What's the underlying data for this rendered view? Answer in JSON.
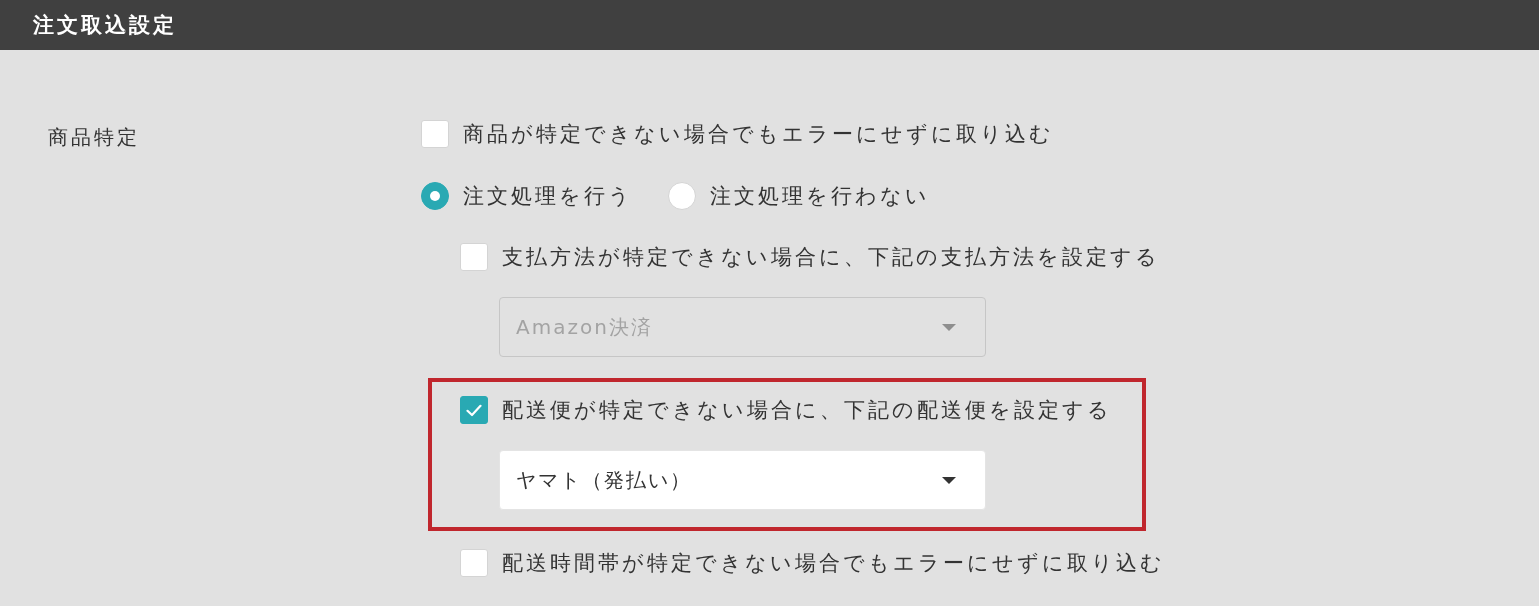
{
  "header": {
    "title": "注文取込設定"
  },
  "section": {
    "label": "商品特定",
    "items": [
      {
        "kind": "checkbox",
        "label": "商品が特定できない場合でもエラーにせずに取り込む",
        "checked": false
      },
      {
        "kind": "radio_group",
        "options": [
          {
            "label": "注文処理を行う",
            "selected": true
          },
          {
            "label": "注文処理を行わない",
            "selected": false
          }
        ],
        "children": [
          {
            "kind": "checkbox",
            "label": "支払方法が特定できない場合に、下記の支払方法を設定する",
            "checked": false,
            "select": {
              "value": "Amazon決済",
              "disabled": true
            }
          },
          {
            "kind": "checkbox",
            "label": "配送便が特定できない場合に、下記の配送便を設定する",
            "checked": true,
            "highlighted": true,
            "select": {
              "value": "ヤマト（発払い）",
              "disabled": false
            }
          },
          {
            "kind": "checkbox",
            "label": "配送時間帯が特定できない場合でもエラーにせずに取り込む",
            "checked": false
          }
        ]
      }
    ]
  }
}
